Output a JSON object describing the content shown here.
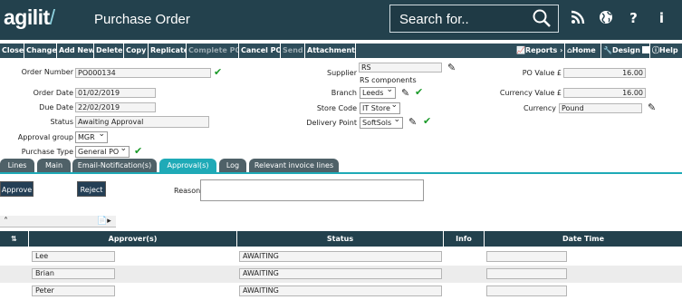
{
  "header": {
    "logo_text": "agilit",
    "logo_slash": "/",
    "title": "Purchase Order",
    "search_placeholder": "Search for..",
    "icons": [
      "rss-icon",
      "globe-icon",
      "help-icon",
      "info-icon"
    ]
  },
  "toolbar": {
    "buttons": [
      "Close",
      "Change",
      "Add New",
      "Delete",
      "Copy",
      "Replicate",
      "Complete PO",
      "Cancel PO",
      "Send",
      "Attachments"
    ],
    "disabled": [
      "Complete PO",
      "Send"
    ],
    "reports": "Reports",
    "reports_arrow": "›",
    "home": "Home",
    "design": "Design",
    "help": "Help"
  },
  "form": {
    "order_number_label": "Order Number",
    "order_number": "PO000134",
    "order_date_label": "Order Date",
    "order_date": "01/02/2019",
    "due_date_label": "Due Date",
    "due_date": "22/02/2019",
    "status_label": "Status",
    "status": "Awaiting Approval",
    "approval_group_label": "Approval group",
    "approval_group": "MGR",
    "purchase_type_label": "Purchase Type",
    "purchase_type": "General PO",
    "supplier_label": "Supplier",
    "supplier": "RS",
    "supplier_name": "RS components",
    "branch_label": "Branch",
    "branch": "Leeds",
    "store_code_label": "Store Code",
    "store_code": "IT Store",
    "delivery_point_label": "Delivery Point",
    "delivery_point": "SoftSols",
    "po_value_label": "PO Value £",
    "po_value": "16.00",
    "currency_value_label": "Currency Value £",
    "currency_value": "16.00",
    "currency_label": "Currency",
    "currency": "Pound"
  },
  "tabs": {
    "items": [
      "Lines",
      "Main",
      "Email-Notification(s)",
      "Approval(s)",
      "Log",
      "Relevant invoice lines"
    ],
    "active": "Approval(s)"
  },
  "approval": {
    "approve": "Approve",
    "reject": "Reject",
    "reason_label": "Reason",
    "reason_value": ""
  },
  "grid": {
    "columns": [
      "Approver(s)",
      "Status",
      "Info",
      "Date Time"
    ],
    "rows": [
      {
        "approver": "Lee",
        "status": "AWAITING",
        "info": "",
        "datetime": ""
      },
      {
        "approver": "Brian",
        "status": "AWAITING",
        "info": "",
        "datetime": ""
      },
      {
        "approver": "Peter",
        "status": "AWAITING",
        "info": "",
        "datetime": ""
      }
    ]
  },
  "colors": {
    "header_bg": "#23414d",
    "toolbar_bg": "#2e4d5a",
    "tab_active": "#1faab7",
    "tab_inactive": "#4f6168",
    "check_green": "#1a9a28"
  }
}
